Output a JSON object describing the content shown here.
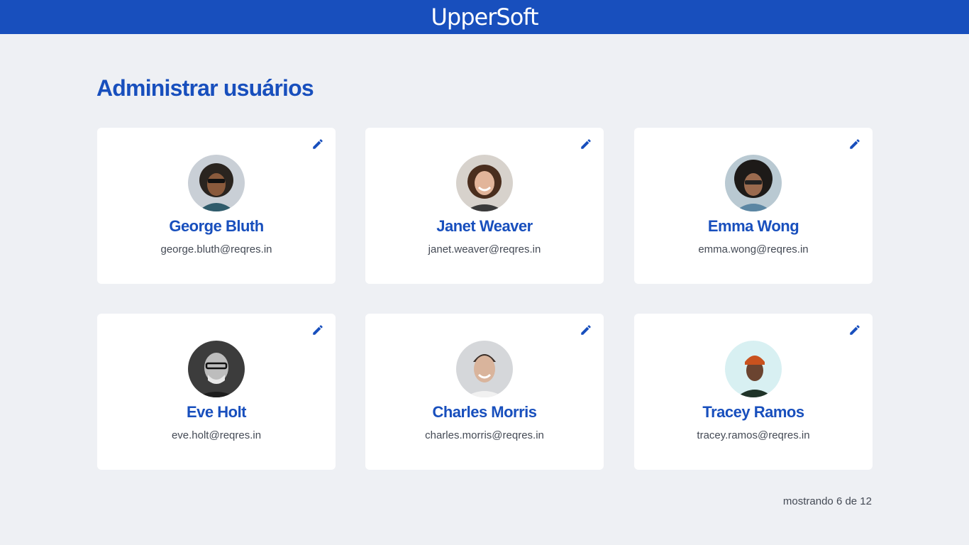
{
  "header": {
    "logo": "UpperSoft"
  },
  "page": {
    "title": "Administrar usuários"
  },
  "users": [
    {
      "name": "George Bluth",
      "email": "george.bluth@reqres.in"
    },
    {
      "name": "Janet Weaver",
      "email": "janet.weaver@reqres.in"
    },
    {
      "name": "Emma Wong",
      "email": "emma.wong@reqres.in"
    },
    {
      "name": "Eve Holt",
      "email": "eve.holt@reqres.in"
    },
    {
      "name": "Charles Morris",
      "email": "charles.morris@reqres.in"
    },
    {
      "name": "Tracey Ramos",
      "email": "tracey.ramos@reqres.in"
    }
  ],
  "pagination": {
    "text": "mostrando 6 de 12"
  },
  "icons": {
    "edit": "pencil-icon",
    "avatar": "user-photo"
  },
  "colors": {
    "primary": "#184fbd",
    "background": "#eef0f4",
    "card": "#ffffff",
    "text": "#444a55"
  }
}
